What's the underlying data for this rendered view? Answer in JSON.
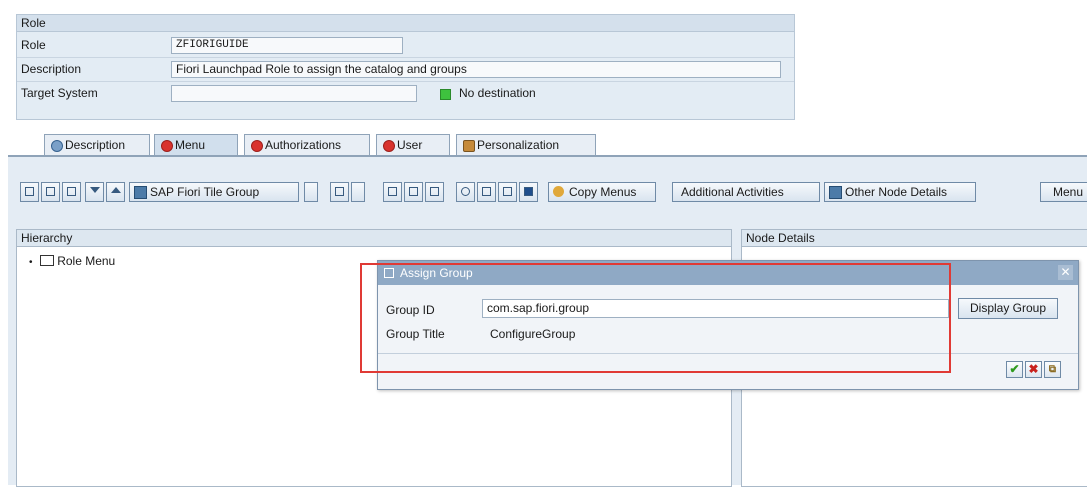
{
  "role_section": {
    "header": "Role",
    "role_label": "Role",
    "role_value": "ZFIORIGUIDE",
    "description_label": "Description",
    "description_value": "Fiori Launchpad Role to assign the catalog and groups",
    "target_label": "Target System",
    "target_value": "",
    "destination_status": "No destination"
  },
  "tabs": [
    {
      "label": "Description",
      "icon": "magnifier-icon"
    },
    {
      "label": "Menu",
      "icon": "red-status-icon",
      "active": true
    },
    {
      "label": "Authorizations",
      "icon": "red-status-icon"
    },
    {
      "label": "User",
      "icon": "red-status-icon"
    },
    {
      "label": "Personalization",
      "icon": "personalization-icon"
    }
  ],
  "toolbar": {
    "tile_group_label": "SAP Fiori Tile Group",
    "copy_menus_label": "Copy Menus",
    "additional_activities_label": "Additional Activities",
    "other_node_details_label": "Other Node Details",
    "menu_label": "Menu"
  },
  "hierarchy": {
    "header": "Hierarchy",
    "root_item": "Role Menu"
  },
  "node_details": {
    "header": "Node Details"
  },
  "dialog": {
    "title": "Assign Group",
    "group_id_label": "Group ID",
    "group_id_value": "com.sap.fiori.group",
    "group_title_label": "Group Title",
    "group_title_value": "ConfigureGroup",
    "display_group_label": "Display Group",
    "close_glyph": "✕"
  },
  "colors": {
    "accent_red": "#e03a35",
    "status_green": "#3ec23e",
    "dialog_title_bg": "#8fa9c5"
  }
}
